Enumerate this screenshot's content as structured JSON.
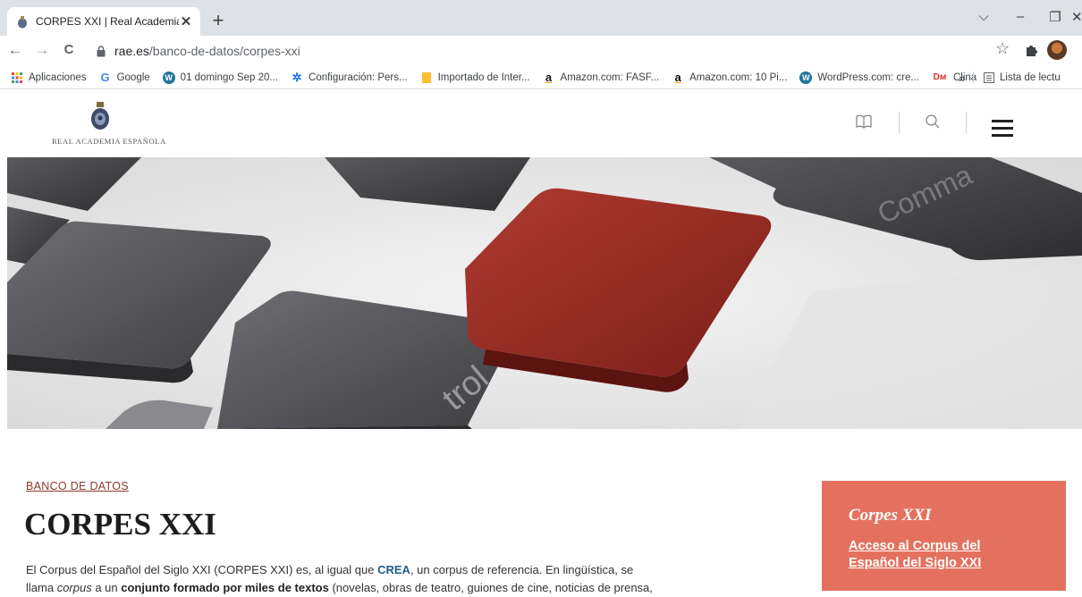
{
  "browser": {
    "tab": {
      "title": "CORPES XXI | Real Academia Esp",
      "close": "✕"
    },
    "new_tab": "+",
    "window_controls": {
      "dropdown": "⌵",
      "minimize": "–",
      "restore": "❐",
      "close": "✕"
    },
    "nav": {
      "back": "←",
      "forward": "→",
      "reload": "C"
    },
    "url": {
      "host": "rae.es",
      "path": "/banco-de-datos/corpes-xxi"
    },
    "toolbar_icons": {
      "star": "☆",
      "extensions": "puzzle-icon"
    }
  },
  "bookmarks": {
    "items": [
      {
        "label": "Aplicaciones",
        "icon": "apps-grid-icon"
      },
      {
        "label": "Google",
        "icon": "google-icon",
        "glyph": "G"
      },
      {
        "label": "01 domingo Sep 20...",
        "icon": "wordpress-icon",
        "glyph": "W"
      },
      {
        "label": "Configuración: Pers...",
        "icon": "gear-icon",
        "glyph": "✲"
      },
      {
        "label": "Importado de Inter...",
        "icon": "folder-icon"
      },
      {
        "label": "Amazon.com: FASF...",
        "icon": "amazon-icon",
        "glyph": "a"
      },
      {
        "label": "Amazon.com: 10 Pi...",
        "icon": "amazon-icon",
        "glyph": "a"
      },
      {
        "label": "WordPress.com: cre...",
        "icon": "wordpress-icon",
        "glyph": "W"
      },
      {
        "label": "Clina",
        "icon": "dm-icon",
        "glyph": "Dм"
      }
    ],
    "overflow": "»",
    "reading_list": "Lista de lectu"
  },
  "site": {
    "logo_text": "REAL ACADEMIA ESPAÑOLA",
    "icons": [
      "book-icon",
      "search-icon",
      "menu-icon"
    ]
  },
  "colors": {
    "accent": "#e4715f",
    "breadcrumb": "#8b3a2c",
    "link": "#1e5d8c",
    "red_key": "#9b2a23"
  },
  "article": {
    "breadcrumb": "BANCO DE DATOS",
    "title": "CORPES XXI",
    "p1_a": "El Corpus del Español del Siglo XXI (CORPES XXI) es, al igual que ",
    "p1_link": "CREA",
    "p1_b": ", un corpus de referencia. En lingüística, se",
    "p2_a": "llama ",
    "p2_em": "corpus",
    "p2_b": " a un ",
    "p2_bold": "conjunto formado por miles de textos",
    "p2_c": " (novelas, obras de teatro, guiones de cine, noticias de prensa,"
  },
  "sidebar": {
    "title": "Corpes XXI",
    "link": "Acceso al Corpus del Español del Siglo XXI"
  }
}
